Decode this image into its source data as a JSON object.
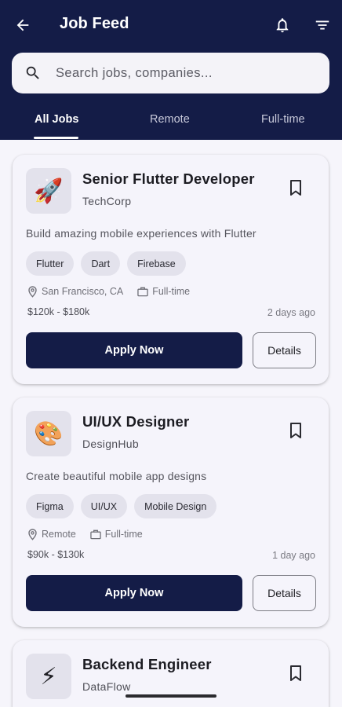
{
  "header": {
    "title": "Job Feed",
    "back_icon": "arrow-left-icon",
    "notifications_icon": "bell-icon",
    "filter_icon": "filter-icon",
    "background": "#141c47"
  },
  "search": {
    "placeholder": "Search jobs, companies...",
    "value": ""
  },
  "tabs": [
    {
      "label": "All Jobs",
      "active": true
    },
    {
      "label": "Remote",
      "active": false
    },
    {
      "label": "Full-time",
      "active": false
    }
  ],
  "jobs": [
    {
      "logo": "🚀",
      "title": "Senior Flutter Developer",
      "company": "TechCorp",
      "description": "Build amazing mobile experiences with Flutter",
      "tags": [
        "Flutter",
        "Dart",
        "Firebase"
      ],
      "location": "San Francisco, CA",
      "type": "Full-time",
      "salary": "$120k - $180k",
      "posted": "2 days ago",
      "apply_label": "Apply Now",
      "details_label": "Details"
    },
    {
      "logo": "🎨",
      "title": "UI/UX Designer",
      "company": "DesignHub",
      "description": "Create beautiful mobile app designs",
      "tags": [
        "Figma",
        "UI/UX",
        "Mobile Design"
      ],
      "location": "Remote",
      "type": "Full-time",
      "salary": "$90k - $130k",
      "posted": "1 day ago",
      "apply_label": "Apply Now",
      "details_label": "Details"
    },
    {
      "logo": "⚡",
      "title": "Backend Engineer",
      "company": "DataFlow"
    }
  ],
  "colors": {
    "primary": "#141c47",
    "card_bg": "#f5f4fb",
    "chip_bg": "#e3e2ec"
  }
}
